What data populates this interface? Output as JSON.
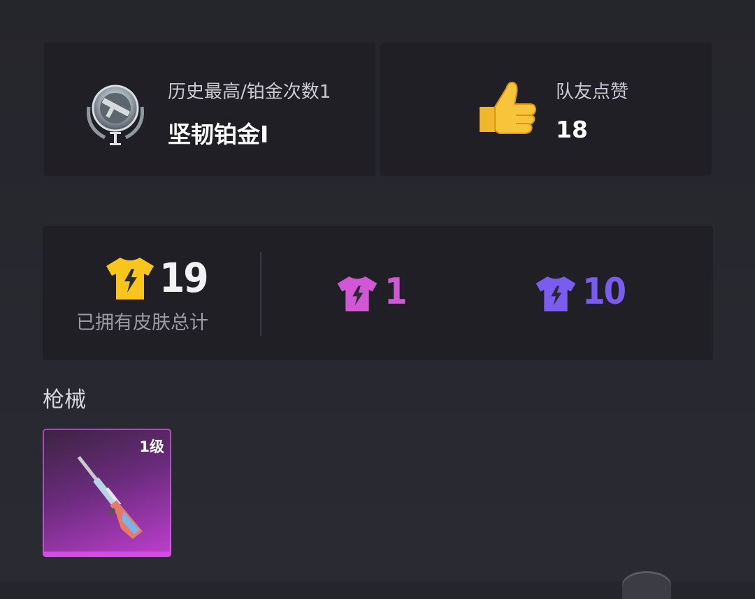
{
  "rank": {
    "label": "历史最高/铂金次数1",
    "tier": "坚韧铂金Ⅰ",
    "badge_icon": "platinum-rank-badge-icon"
  },
  "likes": {
    "label": "队友点赞",
    "count": "18",
    "icon": "thumbs-up-icon"
  },
  "skins": {
    "total": "19",
    "total_label": "已拥有皮肤总计",
    "total_color": "#f7c51c",
    "legendary_count": "1",
    "legendary_color": "#d257d6",
    "epic_count": "10",
    "epic_color": "#7b5cf0",
    "shirt_icon": "shirt-lightning-icon"
  },
  "section": {
    "title": "枪械"
  },
  "weapon": {
    "level": "1级",
    "icon": "rifle-icon",
    "rarity_color": "#c03fd0"
  }
}
